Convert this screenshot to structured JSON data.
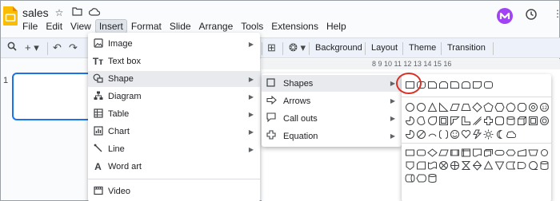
{
  "header": {
    "doc_title": "sales",
    "menu": [
      "File",
      "Edit",
      "View",
      "Insert",
      "Format",
      "Slide",
      "Arrange",
      "Tools",
      "Extensions",
      "Help"
    ],
    "active_menu": "Insert"
  },
  "toolbar": {
    "background_label": "Background",
    "layout_label": "Layout",
    "theme_label": "Theme",
    "transition_label": "Transition"
  },
  "ruler": {
    "labels": "8 9 10 11 12 13 14 15 16"
  },
  "filmstrip": {
    "slide_number": "1"
  },
  "insert_menu": {
    "items": [
      {
        "icon": "image-icon",
        "label": "Image",
        "submenu": true
      },
      {
        "icon": "text-box-icon",
        "label": "Text box",
        "submenu": false
      },
      {
        "icon": "shape-icon",
        "label": "Shape",
        "submenu": true
      },
      {
        "icon": "diagram-icon",
        "label": "Diagram",
        "submenu": true
      },
      {
        "icon": "table-icon",
        "label": "Table",
        "submenu": true
      },
      {
        "icon": "chart-icon",
        "label": "Chart",
        "submenu": true
      },
      {
        "icon": "line-icon",
        "label": "Line",
        "submenu": true
      },
      {
        "icon": "word-art-icon",
        "label": "Word art",
        "submenu": false
      },
      {
        "icon": "video-icon",
        "label": "Video",
        "submenu": false
      }
    ]
  },
  "shape_menu": {
    "items": [
      {
        "icon": "square-icon",
        "label": "Shapes"
      },
      {
        "icon": "arrow-right-icon",
        "label": "Arrows"
      },
      {
        "icon": "callout-icon",
        "label": "Call outs"
      },
      {
        "icon": "plus-icon",
        "label": "Equation"
      }
    ]
  },
  "colors": {
    "accent": "#1a73e8",
    "menu_hover": "#e8eaed",
    "highlight_ring": "#d93025",
    "toolbar_bg": "#edf2fa"
  }
}
